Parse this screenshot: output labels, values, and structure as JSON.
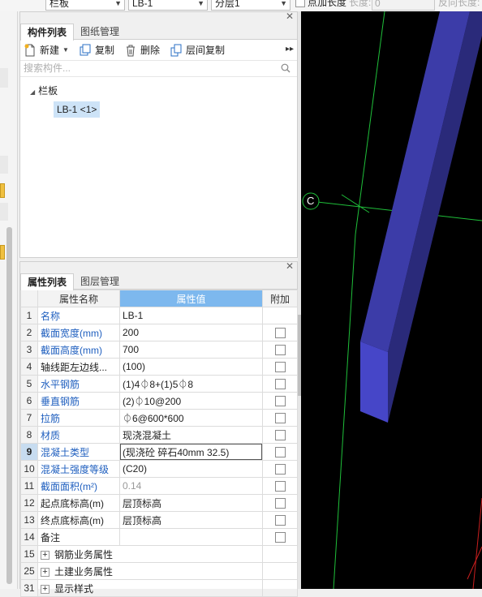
{
  "toolbar": {
    "combo1": "栏板",
    "combo2": "LB-1",
    "combo3": "分层1",
    "point_length_label": "点加长度",
    "length_label": "长度:",
    "length_value": "0",
    "reverse_length_label": "反向长度:"
  },
  "component_panel": {
    "tab_active": "构件列表",
    "tab_inactive": "图纸管理",
    "new_label": "新建",
    "copy_label": "复制",
    "delete_label": "删除",
    "floor_copy_label": "层间复制",
    "search_placeholder": "搜索构件...",
    "tree_root": "栏板",
    "tree_child": "LB-1 <1>"
  },
  "property_panel": {
    "tab_active": "属性列表",
    "tab_inactive": "图层管理",
    "headers": {
      "name": "属性名称",
      "value": "属性值",
      "extra": "附加"
    },
    "rows": [
      {
        "num": "1",
        "name": "名称",
        "value": "LB-1",
        "blue": true,
        "checkbox": false
      },
      {
        "num": "2",
        "name": "截面宽度(mm)",
        "value": "200",
        "blue": true,
        "checkbox": true
      },
      {
        "num": "3",
        "name": "截面高度(mm)",
        "value": "700",
        "blue": true,
        "checkbox": true
      },
      {
        "num": "4",
        "name": "轴线距左边线...",
        "value": "(100)",
        "blue": false,
        "checkbox": true
      },
      {
        "num": "5",
        "name": "水平钢筋",
        "value": "(1)4⏀8+(1)5⏀8",
        "blue": true,
        "checkbox": true
      },
      {
        "num": "6",
        "name": "垂直钢筋",
        "value": "(2)⏀10@200",
        "blue": true,
        "checkbox": true
      },
      {
        "num": "7",
        "name": "拉筋",
        "value": "⏀6@600*600",
        "blue": true,
        "checkbox": true
      },
      {
        "num": "8",
        "name": "材质",
        "value": "现浇混凝土",
        "blue": true,
        "checkbox": true
      },
      {
        "num": "9",
        "name": "混凝土类型",
        "value": "(现浇砼 碎石40mm 32.5)",
        "blue": true,
        "checkbox": true,
        "selected": true
      },
      {
        "num": "10",
        "name": "混凝土强度等级",
        "value": "(C20)",
        "blue": true,
        "checkbox": true
      },
      {
        "num": "11",
        "name": "截面面积(m²)",
        "value": "0.14",
        "blue": true,
        "checkbox": true,
        "gray": true
      },
      {
        "num": "12",
        "name": "起点底标高(m)",
        "value": "层顶标高",
        "blue": false,
        "checkbox": true
      },
      {
        "num": "13",
        "name": "终点底标高(m)",
        "value": "层顶标高",
        "blue": false,
        "checkbox": true
      },
      {
        "num": "14",
        "name": "备注",
        "value": "",
        "blue": false,
        "checkbox": true
      },
      {
        "num": "15",
        "name": "钢筋业务属性",
        "value": "",
        "blue": false,
        "checkbox": false,
        "group": true
      },
      {
        "num": "25",
        "name": "土建业务属性",
        "value": "",
        "blue": false,
        "checkbox": false,
        "group": true
      },
      {
        "num": "31",
        "name": "显示样式",
        "value": "",
        "blue": false,
        "checkbox": false,
        "group": true
      }
    ]
  },
  "canvas": {
    "axis_label": "C"
  },
  "colors": {
    "accent_header": "#7db8ee",
    "blue_text": "#1f5fbf",
    "beam_face": "#3c3ca8",
    "beam_side": "#2a2a7a",
    "beam_end": "#4646c8",
    "axis_green": "#1fbf3a"
  }
}
